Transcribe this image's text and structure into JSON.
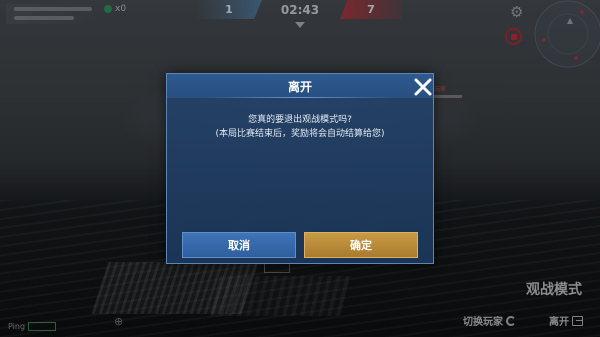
{
  "hud": {
    "kill_count": "x0",
    "team_blue_score": "1",
    "match_timer": "02:43",
    "team_red_score": "7",
    "ping_label": "Ping",
    "spectate_mode_label": "观战模式",
    "switch_player_label": "切换玩家",
    "leave_label": "离开",
    "enemy_tag": "玩家"
  },
  "dialog": {
    "title": "离开",
    "message_line1": "您真的要退出观战模式吗?",
    "message_line2": "(本局比赛结束后，奖励将会自动结算给您)",
    "cancel_label": "取消",
    "confirm_label": "确定"
  },
  "colors": {
    "dialog_bg": "#243f68",
    "cancel_button": "#3a6db0",
    "confirm_button": "#c0903c",
    "team_blue": "#5f96c8",
    "team_red": "#c83c46",
    "record_red": "#d23340"
  },
  "icons": {
    "close": "close-icon",
    "settings": "gear-icon",
    "record": "record-icon",
    "switch": "switch-player-icon",
    "exit": "exit-icon",
    "radar": "minimap-radar-icon"
  }
}
